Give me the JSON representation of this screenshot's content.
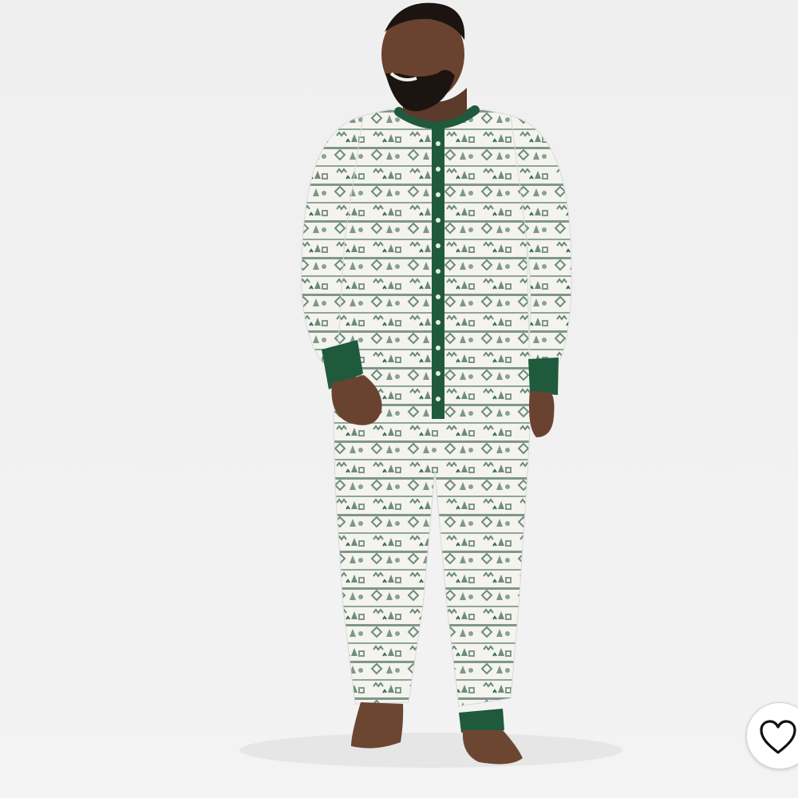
{
  "product": {
    "image_alt": "",
    "accent_color": "#1f5a3c",
    "background_color": "#f0f0f0"
  },
  "favorite": {
    "icon": "heart-outline-icon",
    "state": "not-favorited"
  }
}
